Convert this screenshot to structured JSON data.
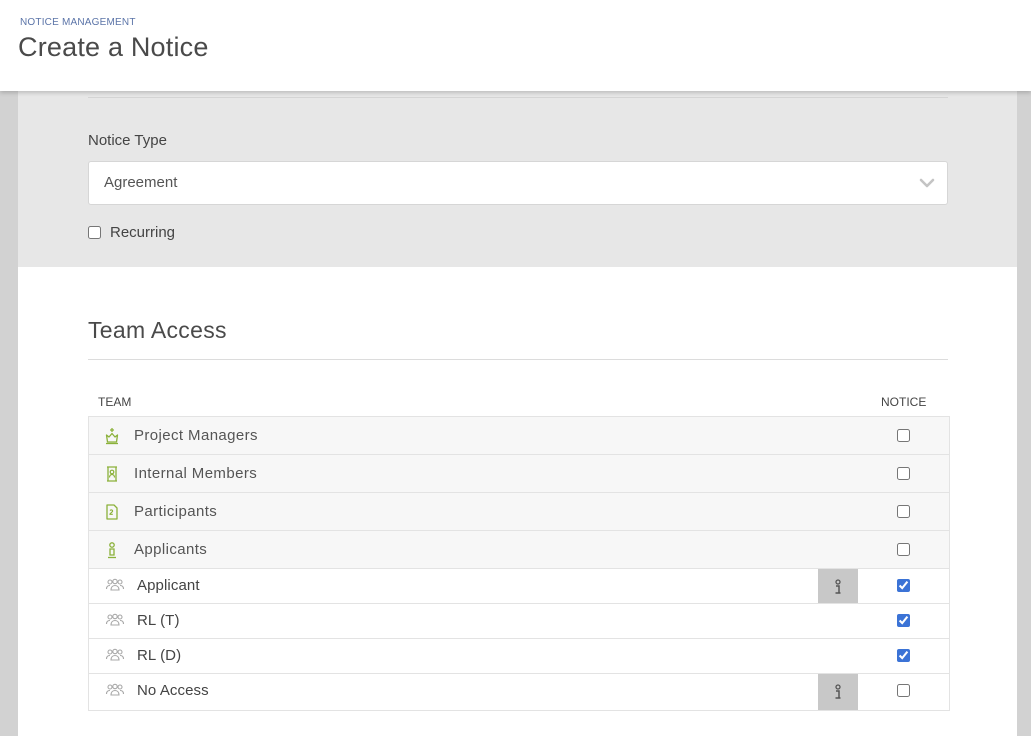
{
  "header": {
    "breadcrumb": "NOTICE MANAGEMENT",
    "title": "Create a Notice"
  },
  "form": {
    "notice_type_label": "Notice Type",
    "notice_type_value": "Agreement",
    "recurring_label": "Recurring",
    "recurring_checked": false
  },
  "team_access": {
    "title": "Team Access",
    "columns": {
      "team": "TEAM",
      "notice": "NOTICE"
    },
    "groups": [
      {
        "label": "Project Managers",
        "icon": "crown-icon",
        "checked": false
      },
      {
        "label": "Internal Members",
        "icon": "badge-icon",
        "checked": false
      },
      {
        "label": "Participants",
        "icon": "document-icon",
        "checked": false
      },
      {
        "label": "Applicants",
        "icon": "person-icon",
        "checked": false
      }
    ],
    "roles": [
      {
        "label": "Applicant",
        "icon": "users-icon",
        "checked": true,
        "has_info": true
      },
      {
        "label": "RL (T)",
        "icon": "users-icon",
        "checked": true,
        "has_info": false
      },
      {
        "label": "RL (D)",
        "icon": "users-icon",
        "checked": true,
        "has_info": false
      },
      {
        "label": "No Access",
        "icon": "users-icon",
        "checked": false,
        "has_info": true
      }
    ]
  },
  "colors": {
    "accent_green": "#8bb13a",
    "breadcrumb_blue": "#5b74a8",
    "checkbox_blue": "#3b73d6"
  }
}
